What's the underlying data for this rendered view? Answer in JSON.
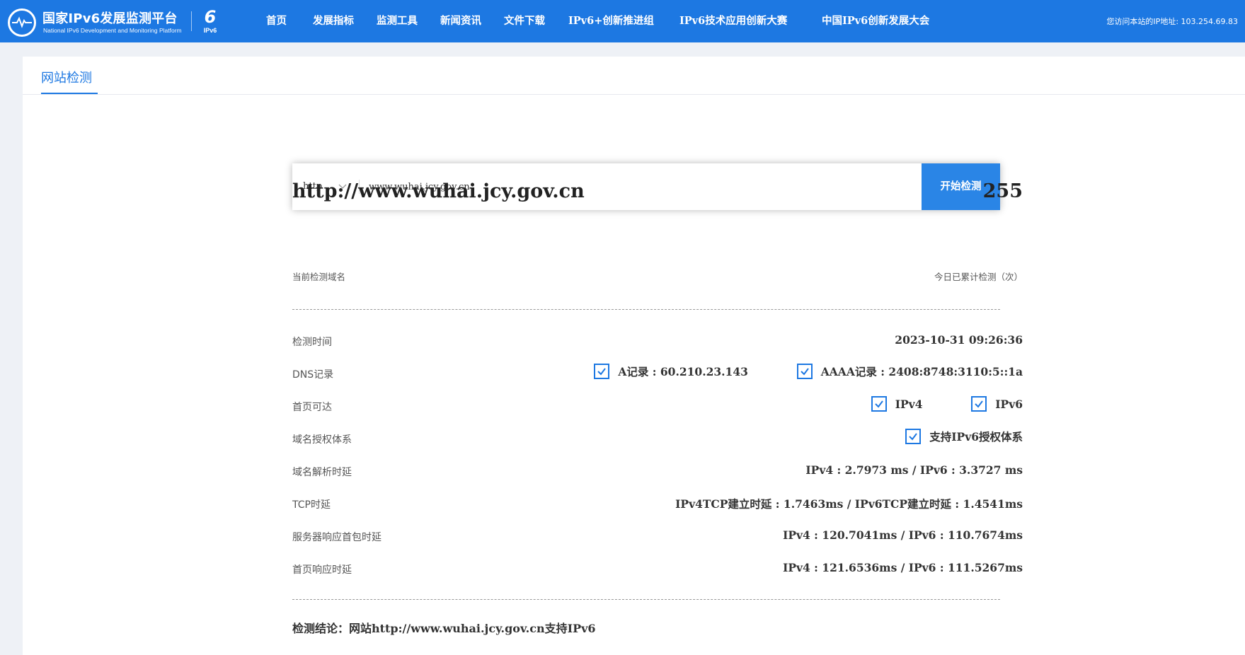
{
  "header": {
    "brand_title": "国家IPv6发展监测平台",
    "brand_subtitle": "National IPv6 Development and Monitoring Platform",
    "ipv6_logo_label": "IPv6",
    "nav": [
      "首页",
      "发展指标",
      "监测工具",
      "新闻资讯",
      "文件下载",
      "IPv6+创新推进组",
      "IPv6技术应用创新大赛",
      "中国IPv6创新发展大会"
    ],
    "ip_info": "您访问本站的IP地址: 103.254.69.83"
  },
  "tab": {
    "title": "网站检测"
  },
  "search": {
    "protocol": "http",
    "url_value": "www.wuhai.jcy.gov.cn",
    "start_label": "开始检测"
  },
  "summary": {
    "domain": "http://www.wuhai.jcy.gov.cn",
    "domain_caption": "当前检测域名",
    "count": "255",
    "count_caption": "今日已累计检测（次）"
  },
  "rows": {
    "check_time": {
      "label": "检测时间",
      "value": "2023-10-31 09:26:36"
    },
    "dns": {
      "label": "DNS记录",
      "a_record": "A记录 : 60.210.23.143",
      "aaaa_record": "AAAA记录 : 2408:8748:3110:5::1a"
    },
    "homepage_reach": {
      "label": "首页可达",
      "ipv4": "IPv4",
      "ipv6": "IPv6"
    },
    "domain_auth": {
      "label": "域名授权体系",
      "value": "支持IPv6授权体系"
    },
    "dns_latency": {
      "label": "域名解析时延",
      "value": "IPv4 : 2.7973 ms / IPv6 : 3.3727 ms"
    },
    "tcp_latency": {
      "label": "TCP时延",
      "value": "IPv4TCP建立时延 : 1.7463ms / IPv6TCP建立时延 : 1.4541ms"
    },
    "first_packet": {
      "label": "服务器响应首包时延",
      "value": "IPv4 : 120.7041ms / IPv6 : 110.7674ms"
    },
    "homepage_latency": {
      "label": "首页响应时延",
      "value": "IPv4 : 121.6536ms / IPv6 : 111.5267ms"
    }
  },
  "conclusion": "检测结论：网站http://www.wuhai.jcy.gov.cn支持IPv6",
  "colors": {
    "primary": "#1d78e2",
    "button": "#2a85e6",
    "background": "#eef1f6"
  }
}
